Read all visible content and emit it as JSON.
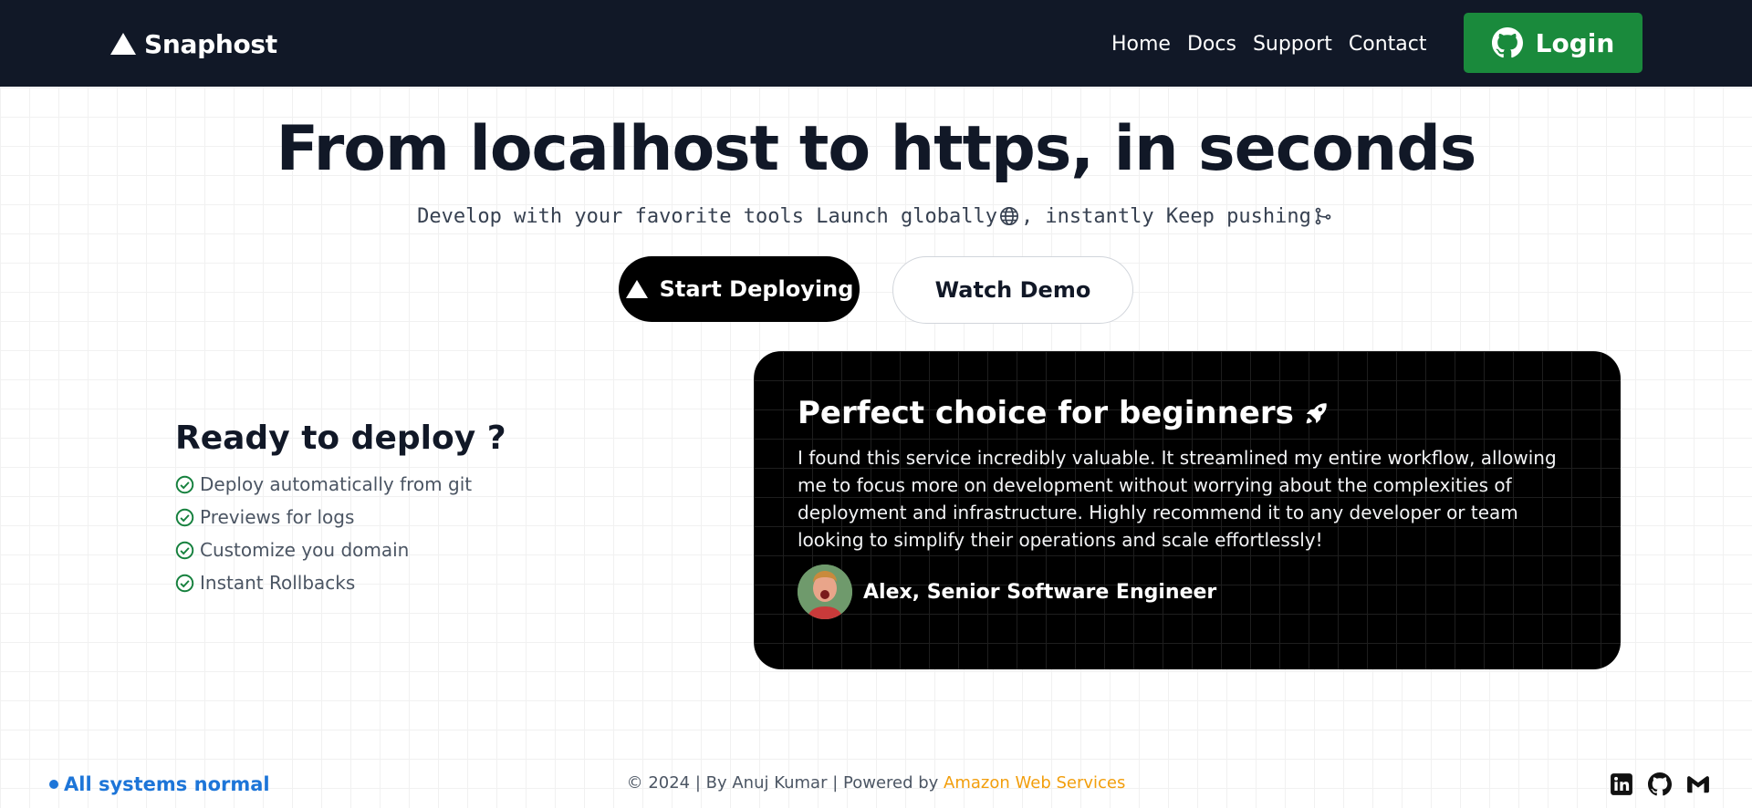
{
  "navbar": {
    "brand": "Snaphost",
    "links": [
      {
        "label": "Home"
      },
      {
        "label": "Docs"
      },
      {
        "label": "Support"
      },
      {
        "label": "Contact"
      }
    ],
    "login_label": "Login",
    "background": "#111827",
    "login_color": "#1a8a3c"
  },
  "hero": {
    "title": "From localhost to https, in seconds",
    "subtitle_part1": "Develop with your favorite tools Launch globally",
    "subtitle_part2": ", instantly Keep pushing",
    "subtitle_icons": [
      "globe-icon",
      "git-branch-icon"
    ],
    "primary_button": "Start Deploying",
    "secondary_button": "Watch Demo"
  },
  "features": {
    "title": "Ready to deploy ?",
    "items": [
      "Deploy automatically from git",
      "Previews for logs",
      "Customize you domain",
      "Instant Rollbacks"
    ],
    "check_color": "#15803d"
  },
  "testimonial": {
    "heading": "Perfect choice for beginners",
    "heading_icon": "rocket-icon",
    "body": "I found this service incredibly valuable. It streamlined my entire workflow, allowing me to focus more on development without worrying about the complexities of deployment and infrastructure. Highly recommend it to any developer or team looking to simplify their operations and scale effortlessly!",
    "author": "Alex, Senior Software Engineer"
  },
  "footer": {
    "status": "All systems normal",
    "status_color": "#1d75d8",
    "copyright": "© 2024 | By Anuj Kumar | Powered by ",
    "powered_by": "Amazon Web Services",
    "powered_by_color": "#f29e0c",
    "socials": [
      "linkedin-icon",
      "github-icon",
      "gmail-icon"
    ]
  }
}
